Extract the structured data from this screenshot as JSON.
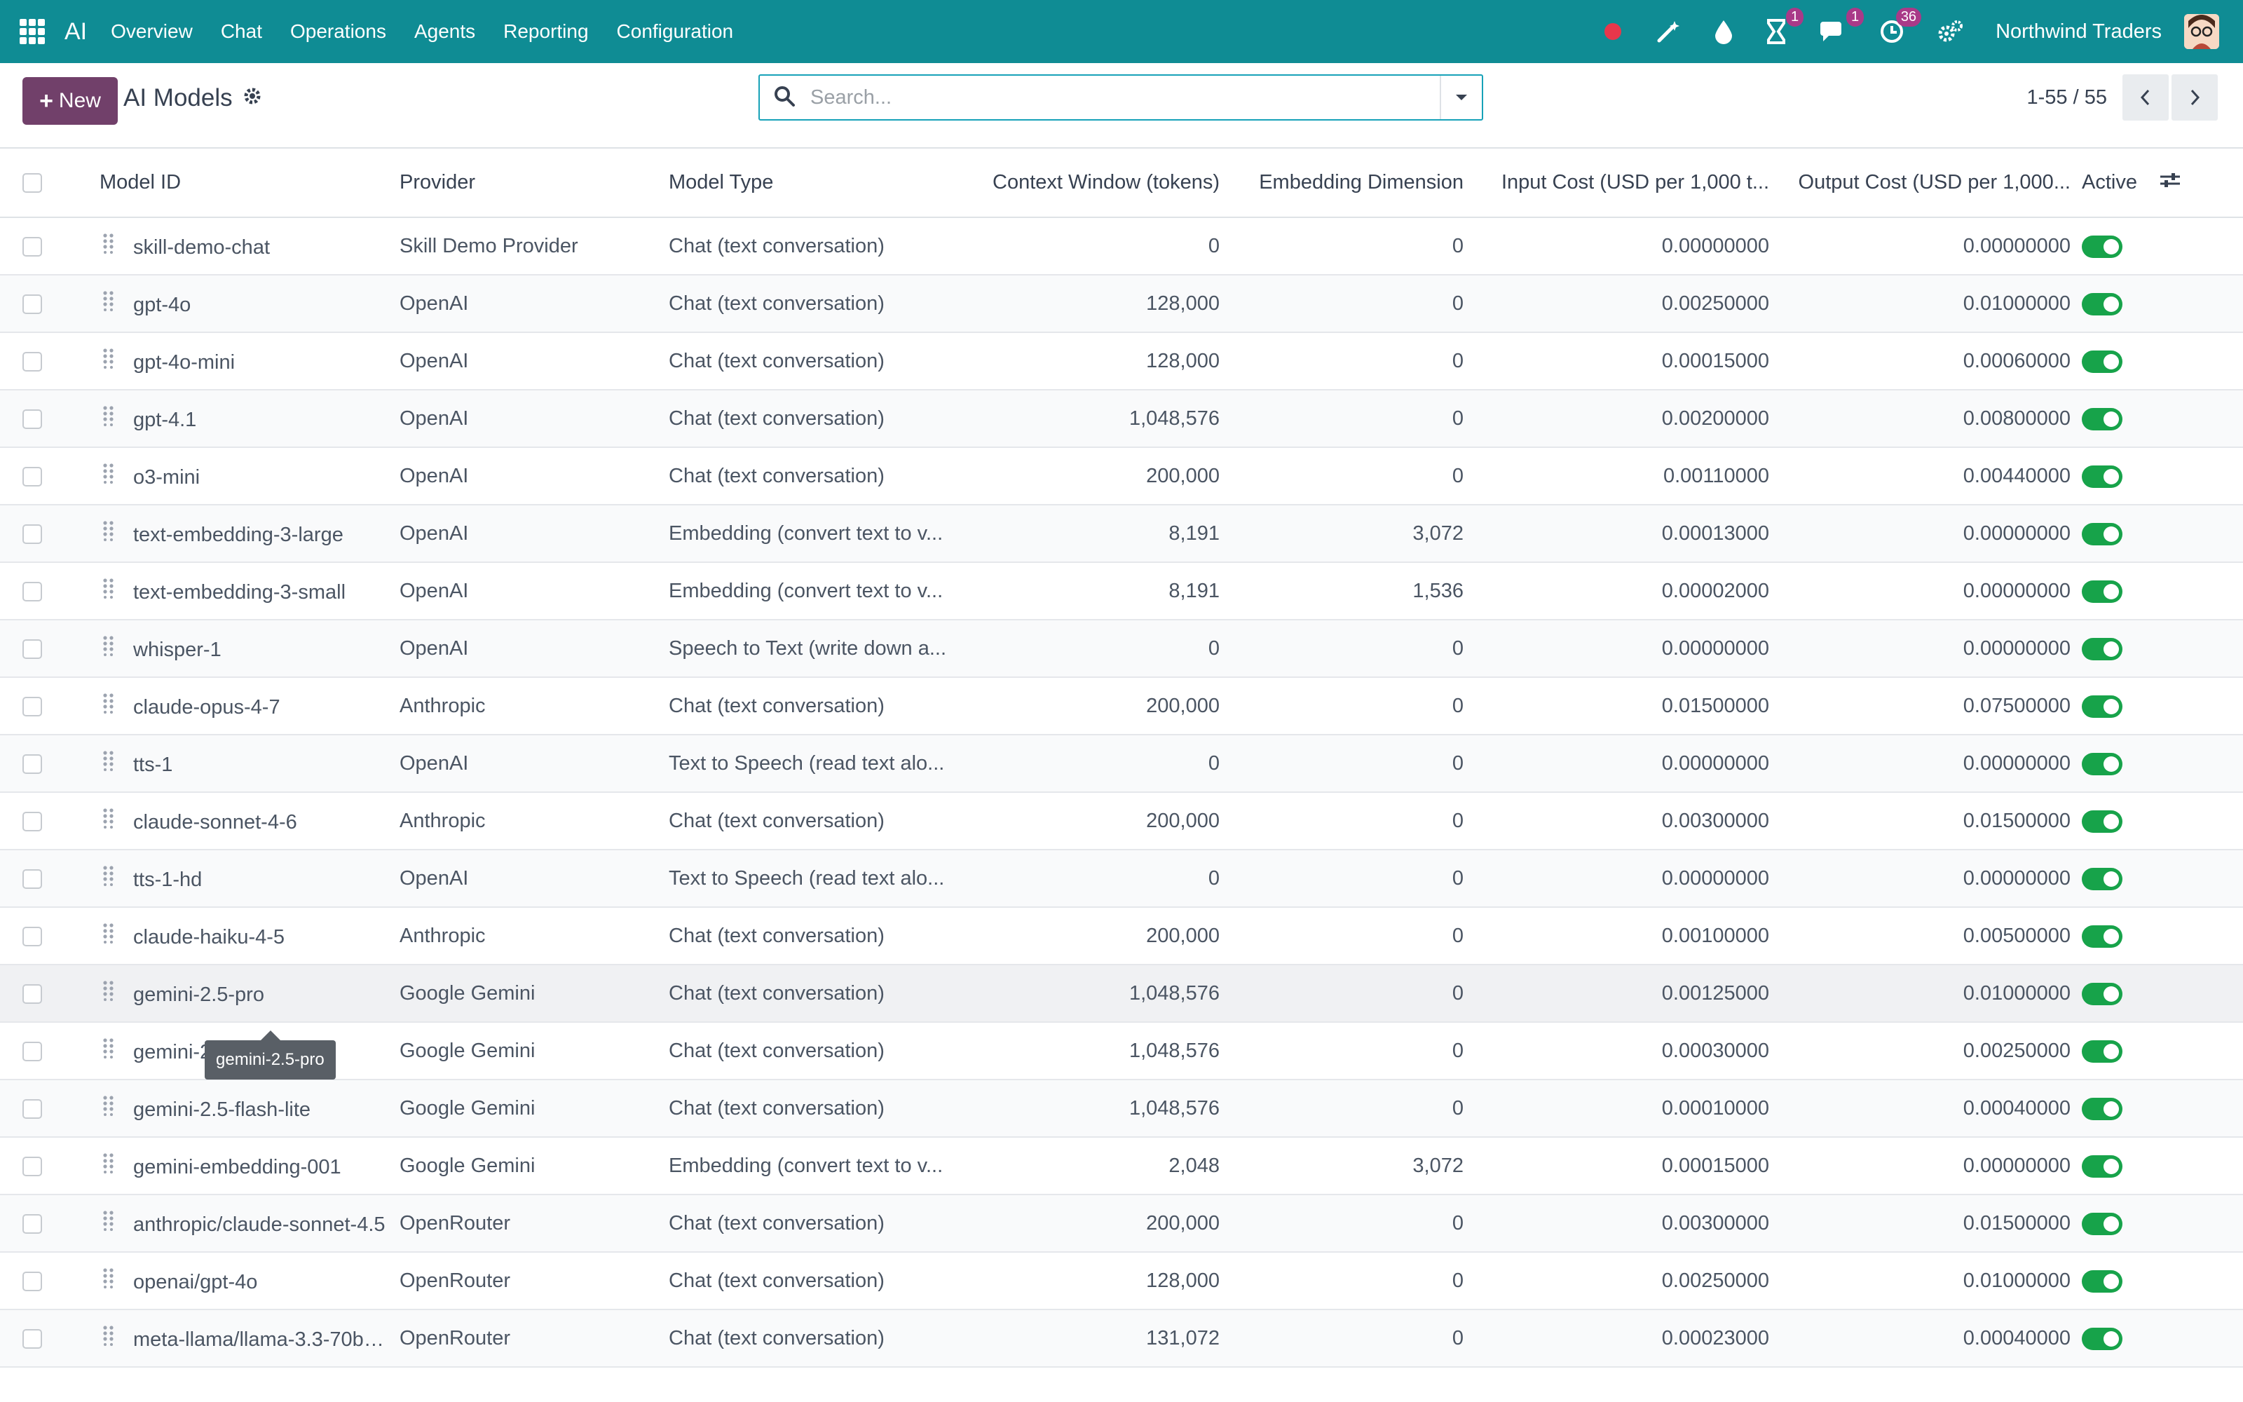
{
  "nav": {
    "app_name": "AI",
    "menus": [
      "Overview",
      "Chat",
      "Operations",
      "Agents",
      "Reporting",
      "Configuration"
    ],
    "company": "Northwind Traders",
    "badges": {
      "activity": "1",
      "messages": "1",
      "clock": "36"
    },
    "record_color": "#e8374b"
  },
  "control": {
    "new_label": "New",
    "title": "AI Models",
    "search_placeholder": "Search...",
    "pager": "1-55 / 55"
  },
  "table": {
    "columns": [
      "Model ID",
      "Provider",
      "Model Type",
      "Context Window (tokens)",
      "Embedding Dimension",
      "Input Cost (USD per 1,000 t...",
      "Output Cost (USD per 1,000...",
      "Active"
    ],
    "rows": [
      {
        "id": "skill-demo-chat",
        "provider": "Skill Demo Provider",
        "type": "Chat (text conversation)",
        "ctx": "0",
        "emb": "0",
        "in": "0.00000000",
        "out": "0.00000000",
        "active": true
      },
      {
        "id": "gpt-4o",
        "provider": "OpenAI",
        "type": "Chat (text conversation)",
        "ctx": "128,000",
        "emb": "0",
        "in": "0.00250000",
        "out": "0.01000000",
        "active": true
      },
      {
        "id": "gpt-4o-mini",
        "provider": "OpenAI",
        "type": "Chat (text conversation)",
        "ctx": "128,000",
        "emb": "0",
        "in": "0.00015000",
        "out": "0.00060000",
        "active": true
      },
      {
        "id": "gpt-4.1",
        "provider": "OpenAI",
        "type": "Chat (text conversation)",
        "ctx": "1,048,576",
        "emb": "0",
        "in": "0.00200000",
        "out": "0.00800000",
        "active": true
      },
      {
        "id": "o3-mini",
        "provider": "OpenAI",
        "type": "Chat (text conversation)",
        "ctx": "200,000",
        "emb": "0",
        "in": "0.00110000",
        "out": "0.00440000",
        "active": true
      },
      {
        "id": "text-embedding-3-large",
        "provider": "OpenAI",
        "type": "Embedding (convert text to v...",
        "ctx": "8,191",
        "emb": "3,072",
        "in": "0.00013000",
        "out": "0.00000000",
        "active": true
      },
      {
        "id": "text-embedding-3-small",
        "provider": "OpenAI",
        "type": "Embedding (convert text to v...",
        "ctx": "8,191",
        "emb": "1,536",
        "in": "0.00002000",
        "out": "0.00000000",
        "active": true
      },
      {
        "id": "whisper-1",
        "provider": "OpenAI",
        "type": "Speech to Text (write down a...",
        "ctx": "0",
        "emb": "0",
        "in": "0.00000000",
        "out": "0.00000000",
        "active": true
      },
      {
        "id": "claude-opus-4-7",
        "provider": "Anthropic",
        "type": "Chat (text conversation)",
        "ctx": "200,000",
        "emb": "0",
        "in": "0.01500000",
        "out": "0.07500000",
        "active": true
      },
      {
        "id": "tts-1",
        "provider": "OpenAI",
        "type": "Text to Speech (read text alo...",
        "ctx": "0",
        "emb": "0",
        "in": "0.00000000",
        "out": "0.00000000",
        "active": true
      },
      {
        "id": "claude-sonnet-4-6",
        "provider": "Anthropic",
        "type": "Chat (text conversation)",
        "ctx": "200,000",
        "emb": "0",
        "in": "0.00300000",
        "out": "0.01500000",
        "active": true
      },
      {
        "id": "tts-1-hd",
        "provider": "OpenAI",
        "type": "Text to Speech (read text alo...",
        "ctx": "0",
        "emb": "0",
        "in": "0.00000000",
        "out": "0.00000000",
        "active": true
      },
      {
        "id": "claude-haiku-4-5",
        "provider": "Anthropic",
        "type": "Chat (text conversation)",
        "ctx": "200,000",
        "emb": "0",
        "in": "0.00100000",
        "out": "0.00500000",
        "active": true
      },
      {
        "id": "gemini-2.5-pro",
        "provider": "Google Gemini",
        "type": "Chat (text conversation)",
        "ctx": "1,048,576",
        "emb": "0",
        "in": "0.00125000",
        "out": "0.01000000",
        "active": true
      },
      {
        "id": "gemini-2.5-flash",
        "provider": "Google Gemini",
        "type": "Chat (text conversation)",
        "ctx": "1,048,576",
        "emb": "0",
        "in": "0.00030000",
        "out": "0.00250000",
        "active": true
      },
      {
        "id": "gemini-2.5-flash-lite",
        "provider": "Google Gemini",
        "type": "Chat (text conversation)",
        "ctx": "1,048,576",
        "emb": "0",
        "in": "0.00010000",
        "out": "0.00040000",
        "active": true
      },
      {
        "id": "gemini-embedding-001",
        "provider": "Google Gemini",
        "type": "Embedding (convert text to v...",
        "ctx": "2,048",
        "emb": "3,072",
        "in": "0.00015000",
        "out": "0.00000000",
        "active": true
      },
      {
        "id": "anthropic/claude-sonnet-4.5",
        "provider": "OpenRouter",
        "type": "Chat (text conversation)",
        "ctx": "200,000",
        "emb": "0",
        "in": "0.00300000",
        "out": "0.01500000",
        "active": true
      },
      {
        "id": "openai/gpt-4o",
        "provider": "OpenRouter",
        "type": "Chat (text conversation)",
        "ctx": "128,000",
        "emb": "0",
        "in": "0.00250000",
        "out": "0.01000000",
        "active": true
      },
      {
        "id": "meta-llama/llama-3.3-70b-ins...",
        "provider": "OpenRouter",
        "type": "Chat (text conversation)",
        "ctx": "131,072",
        "emb": "0",
        "in": "0.00023000",
        "out": "0.00040000",
        "active": true
      }
    ]
  },
  "tooltip": "gemini-2.5-pro",
  "colors": {
    "navbar": "#0f8c94",
    "primary": "#71406a",
    "toggle_on": "#17a34a"
  }
}
